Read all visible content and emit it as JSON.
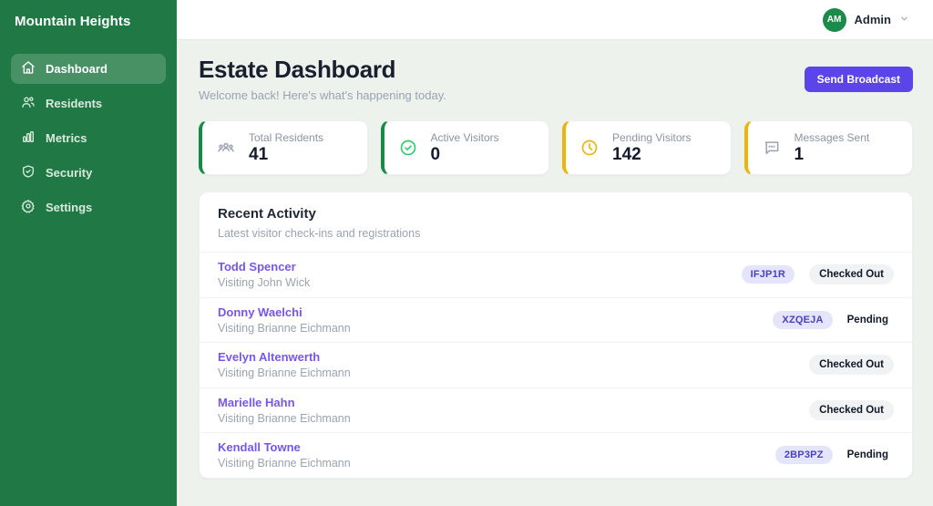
{
  "sidebar": {
    "title": "Mountain Heights",
    "items": [
      {
        "label": "Dashboard"
      },
      {
        "label": "Residents"
      },
      {
        "label": "Metrics"
      },
      {
        "label": "Security"
      },
      {
        "label": "Settings"
      }
    ]
  },
  "topbar": {
    "avatar_initials": "AM",
    "user_name": "Admin"
  },
  "header": {
    "title": "Estate Dashboard",
    "subtitle": "Welcome back! Here's what's happening today.",
    "broadcast_label": "Send Broadcast"
  },
  "stats": [
    {
      "label": "Total Residents",
      "value": "41",
      "accent": "#168a47",
      "icon": "residents-group-icon"
    },
    {
      "label": "Active Visitors",
      "value": "0",
      "accent": "#168a47",
      "icon": "check-circle-icon"
    },
    {
      "label": "Pending Visitors",
      "value": "142",
      "accent": "#ebb50c",
      "icon": "clock-icon"
    },
    {
      "label": "Messages Sent",
      "value": "1",
      "accent": "#ebb50c",
      "icon": "chat-bubble-icon"
    }
  ],
  "activity": {
    "title": "Recent Activity",
    "subtitle": "Latest visitor check-ins and registrations",
    "rows": [
      {
        "name": "Todd Spencer",
        "detail": "Visiting John Wick",
        "code": "IFJP1R",
        "status": "Checked Out"
      },
      {
        "name": "Donny Waelchi",
        "detail": "Visiting Brianne Eichmann",
        "code": "XZQEJA",
        "status": "Pending"
      },
      {
        "name": "Evelyn Altenwerth",
        "detail": "Visiting Brianne Eichmann",
        "code": "",
        "status": "Checked Out"
      },
      {
        "name": "Marielle Hahn",
        "detail": "Visiting Brianne Eichmann",
        "code": "",
        "status": "Checked Out"
      },
      {
        "name": "Kendall Towne",
        "detail": "Visiting Brianne Eichmann",
        "code": "2BP3PZ",
        "status": "Pending"
      }
    ]
  },
  "colors": {
    "sidebar_green": "#207944",
    "accent_green": "#168a47",
    "accent_amber": "#ebb50c",
    "button_purple": "#5b45e8",
    "link_purple": "#7856eb",
    "badge_bg": "#e4e4fa",
    "main_bg": "#edf2ed"
  }
}
